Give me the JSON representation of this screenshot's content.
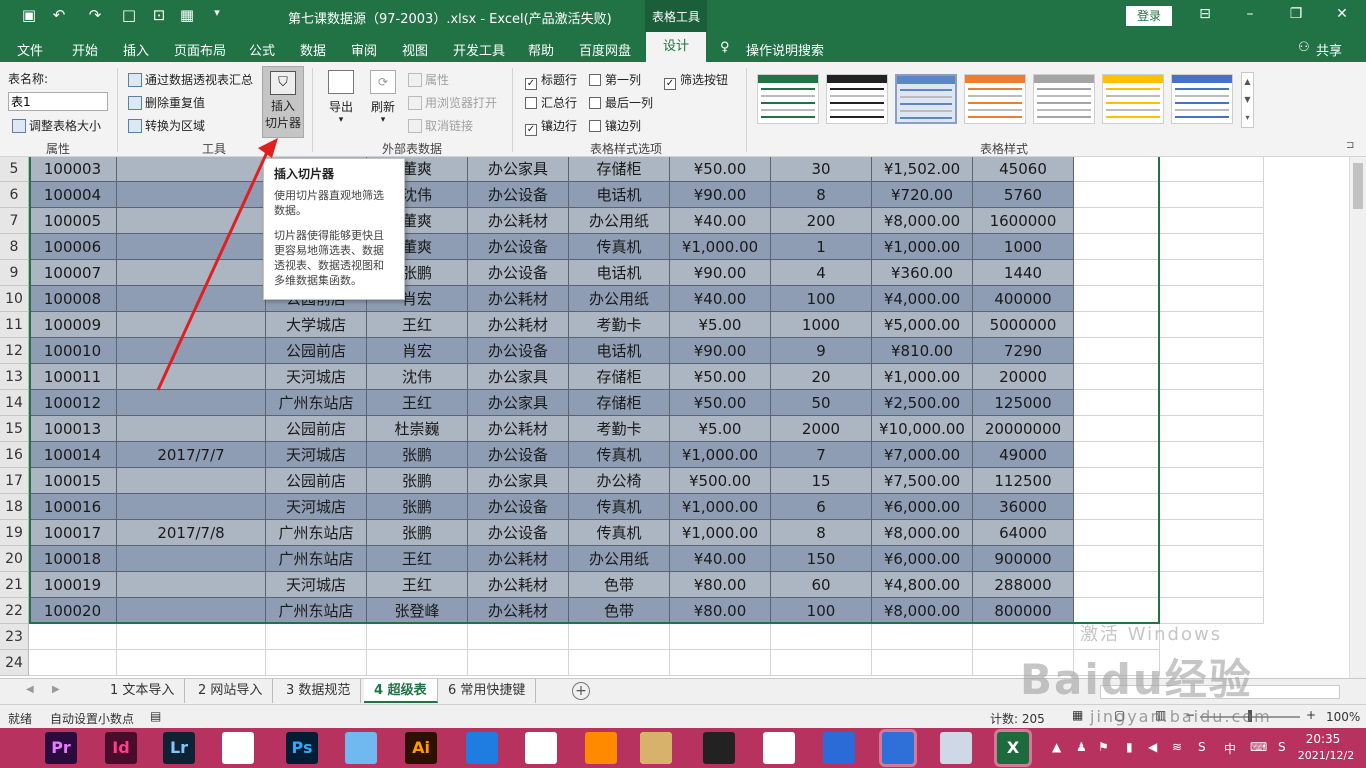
{
  "window": {
    "title": "第七课数据源（97-2003）.xlsx  -  Excel(产品激活失败)",
    "context_group": "表格工具",
    "login_label": "登录",
    "share_label": "共享"
  },
  "menu": {
    "tabs": [
      "文件",
      "开始",
      "插入",
      "页面布局",
      "公式",
      "数据",
      "审阅",
      "视图",
      "开发工具",
      "帮助",
      "百度网盘",
      "设计"
    ],
    "active_tab": "设计",
    "tell_me": "操作说明搜索"
  },
  "ribbon": {
    "properties": {
      "name_label": "表名称:",
      "name_value": "表1",
      "resize_label": "调整表格大小",
      "group": "属性"
    },
    "tools": {
      "pivot": "通过数据透视表汇总",
      "dedupe": "删除重复值",
      "convert": "转换为区域",
      "slicer_line1": "插入",
      "slicer_line2": "切片器",
      "group": "工具"
    },
    "external": {
      "export": "导出",
      "refresh": "刷新",
      "props": "属性",
      "open_browser": "用浏览器打开",
      "unlink": "取消链接",
      "group": "外部表数据"
    },
    "style_options": {
      "header_row": "标题行",
      "first_col": "第一列",
      "filter_btn": "筛选按钮",
      "total_row": "汇总行",
      "last_col": "最后一列",
      "banded_rows": "镶边行",
      "banded_cols": "镶边列",
      "group": "表格样式选项"
    },
    "table_styles": {
      "group": "表格样式",
      "colors": [
        "#217346",
        "#222222",
        "#5b87c2",
        "#ed7d31",
        "#a5a5a5",
        "#ffc000",
        "#4472c4"
      ]
    }
  },
  "tooltip": {
    "title": "插入切片器",
    "p1": "使用切片器直观地筛选数据。",
    "p2": "切片器使得能够更快且更容易地筛选表、数据透视表、数据透视图和多维数据集函数。"
  },
  "grid": {
    "row_numbers": [
      "5",
      "6",
      "7",
      "8",
      "9",
      "10",
      "11",
      "12",
      "13",
      "14",
      "15",
      "16",
      "17",
      "18",
      "19",
      "20",
      "21",
      "22",
      "23",
      "24"
    ],
    "rows": [
      [
        "100003",
        "",
        "河城店",
        "董爽",
        "办公家具",
        "存储柜",
        "¥50.00",
        "30",
        "¥1,502.00",
        "45060"
      ],
      [
        "100004",
        "",
        "学城店",
        "沈伟",
        "办公设备",
        "电话机",
        "¥90.00",
        "8",
        "¥720.00",
        "5760"
      ],
      [
        "100005",
        "",
        "州东站店",
        "董爽",
        "办公耗材",
        "办公用纸",
        "¥40.00",
        "200",
        "¥8,000.00",
        "1600000"
      ],
      [
        "100006",
        "",
        "州东站店",
        "董爽",
        "办公设备",
        "传真机",
        "¥1,000.00",
        "1",
        "¥1,000.00",
        "1000"
      ],
      [
        "100007",
        "",
        "州东站店",
        "张鹏",
        "办公设备",
        "电话机",
        "¥90.00",
        "4",
        "¥360.00",
        "1440"
      ],
      [
        "100008",
        "",
        "公园前店",
        "肖宏",
        "办公耗材",
        "办公用纸",
        "¥40.00",
        "100",
        "¥4,000.00",
        "400000"
      ],
      [
        "100009",
        "",
        "大学城店",
        "王红",
        "办公耗材",
        "考勤卡",
        "¥5.00",
        "1000",
        "¥5,000.00",
        "5000000"
      ],
      [
        "100010",
        "",
        "公园前店",
        "肖宏",
        "办公设备",
        "电话机",
        "¥90.00",
        "9",
        "¥810.00",
        "7290"
      ],
      [
        "100011",
        "",
        "天河城店",
        "沈伟",
        "办公家具",
        "存储柜",
        "¥50.00",
        "20",
        "¥1,000.00",
        "20000"
      ],
      [
        "100012",
        "",
        "广州东站店",
        "王红",
        "办公家具",
        "存储柜",
        "¥50.00",
        "50",
        "¥2,500.00",
        "125000"
      ],
      [
        "100013",
        "",
        "公园前店",
        "杜崇巍",
        "办公耗材",
        "考勤卡",
        "¥5.00",
        "2000",
        "¥10,000.00",
        "20000000"
      ],
      [
        "100014",
        "2017/7/7",
        "天河城店",
        "张鹏",
        "办公设备",
        "传真机",
        "¥1,000.00",
        "7",
        "¥7,000.00",
        "49000"
      ],
      [
        "100015",
        "",
        "公园前店",
        "张鹏",
        "办公家具",
        "办公椅",
        "¥500.00",
        "15",
        "¥7,500.00",
        "112500"
      ],
      [
        "100016",
        "",
        "天河城店",
        "张鹏",
        "办公设备",
        "传真机",
        "¥1,000.00",
        "6",
        "¥6,000.00",
        "36000"
      ],
      [
        "100017",
        "2017/7/8",
        "广州东站店",
        "张鹏",
        "办公设备",
        "传真机",
        "¥1,000.00",
        "8",
        "¥8,000.00",
        "64000"
      ],
      [
        "100018",
        "",
        "广州东站店",
        "王红",
        "办公耗材",
        "办公用纸",
        "¥40.00",
        "150",
        "¥6,000.00",
        "900000"
      ],
      [
        "100019",
        "",
        "天河城店",
        "王红",
        "办公耗材",
        "色带",
        "¥80.00",
        "60",
        "¥4,800.00",
        "288000"
      ],
      [
        "100020",
        "",
        "广州东站店",
        "张登峰",
        "办公耗材",
        "色带",
        "¥80.00",
        "100",
        "¥8,000.00",
        "800000"
      ]
    ]
  },
  "sheets": [
    "1 文本导入",
    "2 网站导入",
    "3 数据规范",
    "4 超级表",
    "6 常用快捷键"
  ],
  "active_sheet": "4 超级表",
  "status": {
    "ready": "就绪",
    "auto_decimal": "自动设置小数点",
    "count": "计数: 205",
    "zoom": "100%"
  },
  "taskbar": {
    "apps": [
      "Pr",
      "Id",
      "Lr",
      "",
      "Ps",
      "",
      "Ai",
      "",
      "",
      "",
      "",
      "",
      "",
      "",
      "",
      "",
      "X"
    ],
    "time": "20:35",
    "date": "2021/12/2",
    "ime": "中"
  },
  "watermark": {
    "text": "Baidu经验",
    "sub": "jingyan.baidu.com",
    "activate": "激活 Windows"
  }
}
